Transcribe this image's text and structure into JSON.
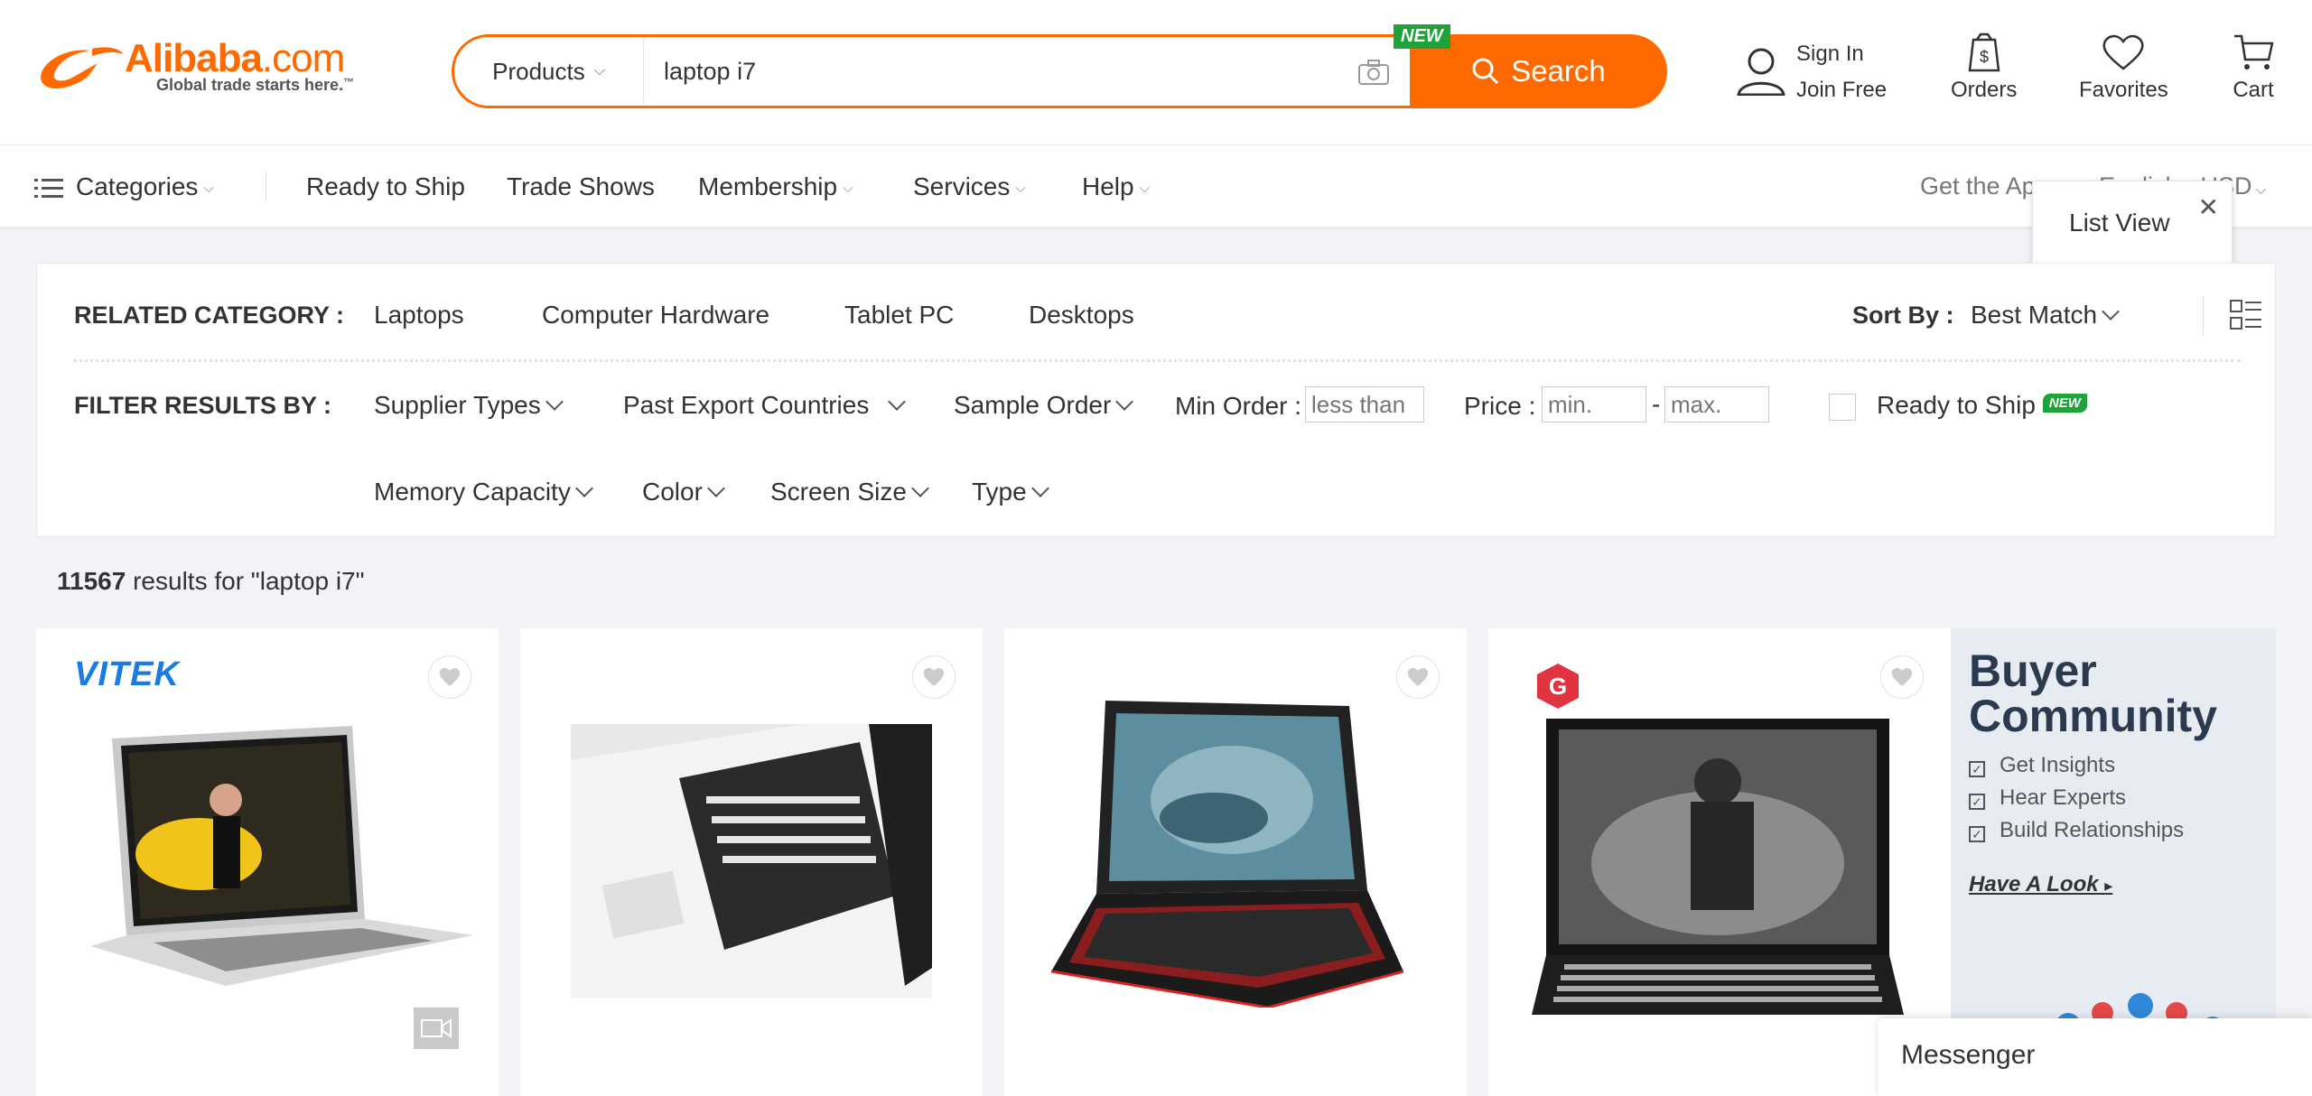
{
  "header": {
    "logo_text": "Alibaba",
    "logo_suffix": ".com",
    "logo_tagline": "Global trade starts here.",
    "logo_tm": "™",
    "search": {
      "category": "Products",
      "query": "laptop i7",
      "button_label": "Search",
      "new_badge": "NEW"
    },
    "sign_in": "Sign In",
    "join_free": "Join Free",
    "orders": "Orders",
    "favorites": "Favorites",
    "cart": "Cart"
  },
  "nav": {
    "categories": "Categories",
    "items": [
      "Ready to Ship",
      "Trade Shows",
      "Membership",
      "Services",
      "Help"
    ],
    "get_app": "Get the Ap",
    "language": "English - USD"
  },
  "tooltip": {
    "text": "List View"
  },
  "filters": {
    "related_label": "RELATED CATEGORY :",
    "related": [
      "Laptops",
      "Computer Hardware",
      "Tablet PC",
      "Desktops"
    ],
    "sort_label": "Sort By :",
    "sort_value": "Best Match",
    "filter_label": "FILTER RESULTS BY :",
    "row1": [
      "Supplier Types",
      "Past Export Countries",
      "Sample Order"
    ],
    "min_order_label": "Min Order :",
    "min_order_placeholder": "less than",
    "price_label": "Price :",
    "price_min_placeholder": "min.",
    "price_dash": "-",
    "price_max_placeholder": "max.",
    "ready_to_ship": "Ready to Ship",
    "ready_new": "NEW",
    "row2": [
      "Memory Capacity",
      "Color",
      "Screen Size",
      "Type"
    ]
  },
  "results": {
    "count": "11567",
    "text": " results for \"laptop i7\""
  },
  "cards": [
    {
      "brand": "VITEK"
    },
    {
      "brand": ""
    },
    {
      "brand": ""
    },
    {
      "brand": "G"
    }
  ],
  "banner": {
    "title_line1": "Buyer",
    "title_line2": "Community",
    "items": [
      "Get Insights",
      "Hear Experts",
      "Build Relationships"
    ],
    "link": "Have A Look"
  },
  "messenger": "Messenger",
  "colors": {
    "accent": "#ff6a00",
    "new_green": "#1fa23a",
    "vitek_blue": "#1a7be0"
  }
}
